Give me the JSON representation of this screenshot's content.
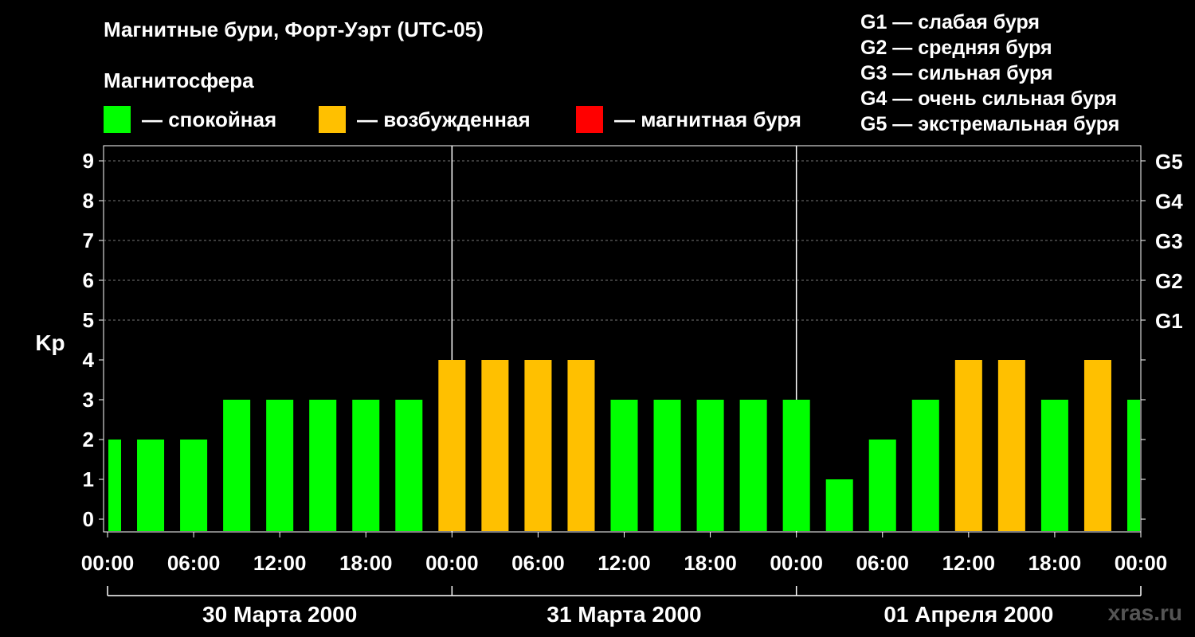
{
  "header": {
    "title": "Магнитные бури, Форт-Уэрт (UTC-05)",
    "subtitle": "Магнитосфера"
  },
  "legend": [
    {
      "color": "#00ff00",
      "label": "— спокойная"
    },
    {
      "color": "#ffc000",
      "label": "— возбужденная"
    },
    {
      "color": "#ff0000",
      "label": "— магнитная буря"
    }
  ],
  "storm_scale": [
    "G1 — слабая буря",
    "G2 — средняя буря",
    "G3 — сильная буря",
    "G4 — очень сильная буря",
    "G5 — экстремальная буря"
  ],
  "watermark": "xras.ru",
  "chart_data": {
    "type": "bar",
    "ylabel": "Kp",
    "ylim": [
      0,
      9
    ],
    "yticks": [
      "0",
      "1",
      "2",
      "3",
      "4",
      "5",
      "6",
      "7",
      "8",
      "9"
    ],
    "right_ticks": [
      {
        "kp": 5,
        "label": "G1"
      },
      {
        "kp": 6,
        "label": "G2"
      },
      {
        "kp": 7,
        "label": "G3"
      },
      {
        "kp": 8,
        "label": "G4"
      },
      {
        "kp": 9,
        "label": "G5"
      }
    ],
    "grid": true,
    "x_tick_labels": [
      "00:00",
      "06:00",
      "12:00",
      "18:00",
      "00:00",
      "06:00",
      "12:00",
      "18:00",
      "00:00",
      "06:00",
      "12:00",
      "18:00",
      "00:00"
    ],
    "days": [
      "30 Марта 2000",
      "31 Марта 2000",
      "01 Апреля 2000"
    ],
    "bar_start_hour": [
      0,
      2,
      5,
      8,
      11,
      14,
      17,
      20,
      23,
      26,
      29,
      32,
      35,
      38,
      41,
      44,
      47,
      50,
      53,
      56,
      59,
      62,
      65,
      68,
      71
    ],
    "bar_end_hour": [
      1,
      4,
      7,
      10,
      13,
      16,
      19,
      22,
      25,
      28,
      31,
      34,
      37,
      40,
      43,
      46,
      49,
      52,
      55,
      58,
      61,
      64,
      67,
      70,
      72
    ],
    "values": [
      2,
      2,
      2,
      3,
      3,
      3,
      3,
      3,
      4,
      4,
      4,
      4,
      3,
      3,
      3,
      3,
      3,
      1,
      2,
      3,
      4,
      4,
      3,
      4,
      3
    ],
    "colors": {
      "quiet": "#00ff00",
      "active": "#ffc000",
      "storm": "#ff0000"
    }
  }
}
